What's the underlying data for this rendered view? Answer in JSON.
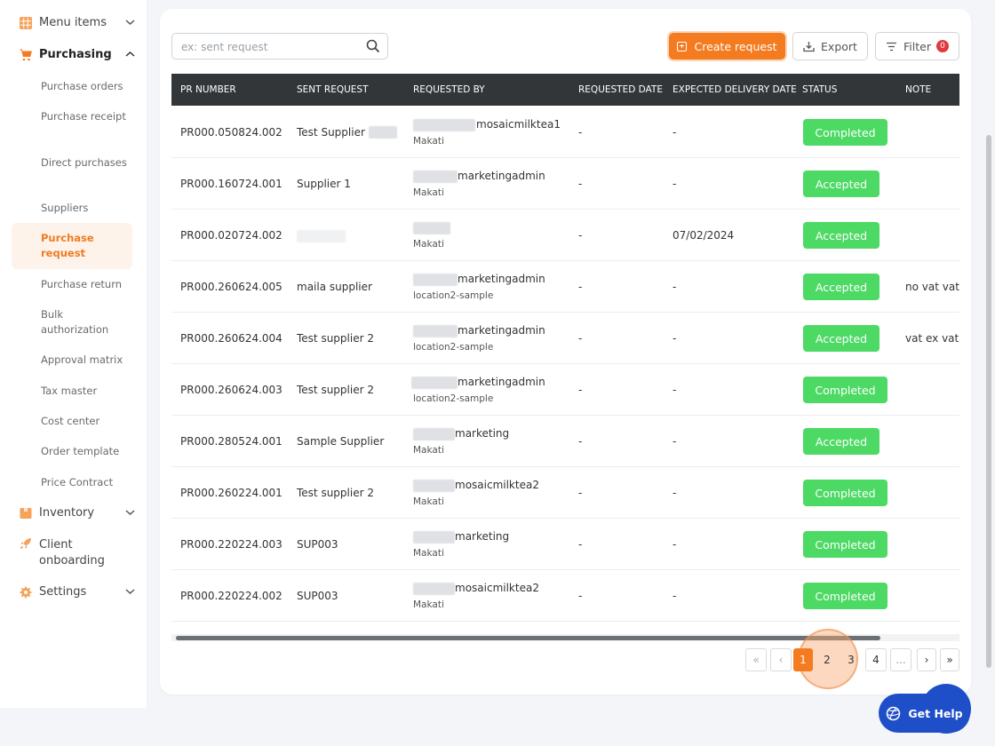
{
  "sidebar": {
    "menu_items": "Menu items",
    "purchasing": "Purchasing",
    "sub_items": [
      "Purchase orders",
      "Purchase receipt",
      "Direct purchases",
      "Suppliers",
      "Purchase request",
      "Purchase return",
      "Bulk authorization",
      "Approval matrix",
      "Tax master",
      "Cost center",
      "Order template",
      "Price Contract"
    ],
    "inventory": "Inventory",
    "client_onboarding": "Client onboarding",
    "settings": "Settings"
  },
  "toolbar": {
    "search_placeholder": "ex: sent request",
    "create_label": "Create request",
    "export_label": "Export",
    "filter_label": "Filter",
    "filter_count": "0"
  },
  "table": {
    "headers": [
      "PR NUMBER",
      "SENT REQUEST",
      "REQUESTED BY",
      "REQUESTED DATE",
      "EXPECTED DELIVERY DATE",
      "STATUS",
      "NOTE"
    ],
    "rows": [
      {
        "pr": "PR000.050824.002",
        "sent": "Test Supplier",
        "by": "mosaicmilktea1",
        "loc": "Makati",
        "req_date": "-",
        "exp_date": "-",
        "status": "Completed",
        "note": ""
      },
      {
        "pr": "PR000.160724.001",
        "sent": "Supplier 1",
        "by": "marketingadmin",
        "loc": "Makati",
        "req_date": "-",
        "exp_date": "-",
        "status": "Accepted",
        "note": ""
      },
      {
        "pr": "PR000.020724.002",
        "sent": "",
        "by": "",
        "loc": "Makati",
        "req_date": "-",
        "exp_date": "07/02/2024",
        "status": "Accepted",
        "note": ""
      },
      {
        "pr": "PR000.260624.005",
        "sent": "maila supplier",
        "by": "marketingadmin",
        "loc": "location2-sample",
        "req_date": "-",
        "exp_date": "-",
        "status": "Accepted",
        "note": "no vat vat"
      },
      {
        "pr": "PR000.260624.004",
        "sent": "Test supplier 2",
        "by": "marketingadmin",
        "loc": "location2-sample",
        "req_date": "-",
        "exp_date": "-",
        "status": "Accepted",
        "note": "vat ex vat"
      },
      {
        "pr": "PR000.260624.003",
        "sent": "Test supplier 2",
        "by": "marketingadmin",
        "loc": "location2-sample",
        "req_date": "-",
        "exp_date": "-",
        "status": "Completed",
        "note": ""
      },
      {
        "pr": "PR000.280524.001",
        "sent": "Sample Supplier",
        "by": "marketing",
        "loc": "Makati",
        "req_date": "-",
        "exp_date": "-",
        "status": "Accepted",
        "note": ""
      },
      {
        "pr": "PR000.260224.001",
        "sent": "Test supplier 2",
        "by": "mosaicmilktea2",
        "loc": "Makati",
        "req_date": "-",
        "exp_date": "-",
        "status": "Completed",
        "note": ""
      },
      {
        "pr": "PR000.220224.003",
        "sent": "SUP003",
        "by": "marketing",
        "loc": "Makati",
        "req_date": "-",
        "exp_date": "-",
        "status": "Completed",
        "note": ""
      },
      {
        "pr": "PR000.220224.002",
        "sent": "SUP003",
        "by": "mosaicmilktea2",
        "loc": "Makati",
        "req_date": "-",
        "exp_date": "-",
        "status": "Completed",
        "note": ""
      }
    ]
  },
  "pagination": {
    "first": "«",
    "prev": "‹",
    "pages": [
      "1",
      "2",
      "3",
      "4"
    ],
    "ellipsis": "...",
    "next": "›",
    "last": "»"
  },
  "help": {
    "label": "Get Help"
  },
  "colors": {
    "accent": "#f47b20",
    "status_green": "#4cd964",
    "header_dark": "#333638",
    "help_blue": "#1f4fc8"
  }
}
